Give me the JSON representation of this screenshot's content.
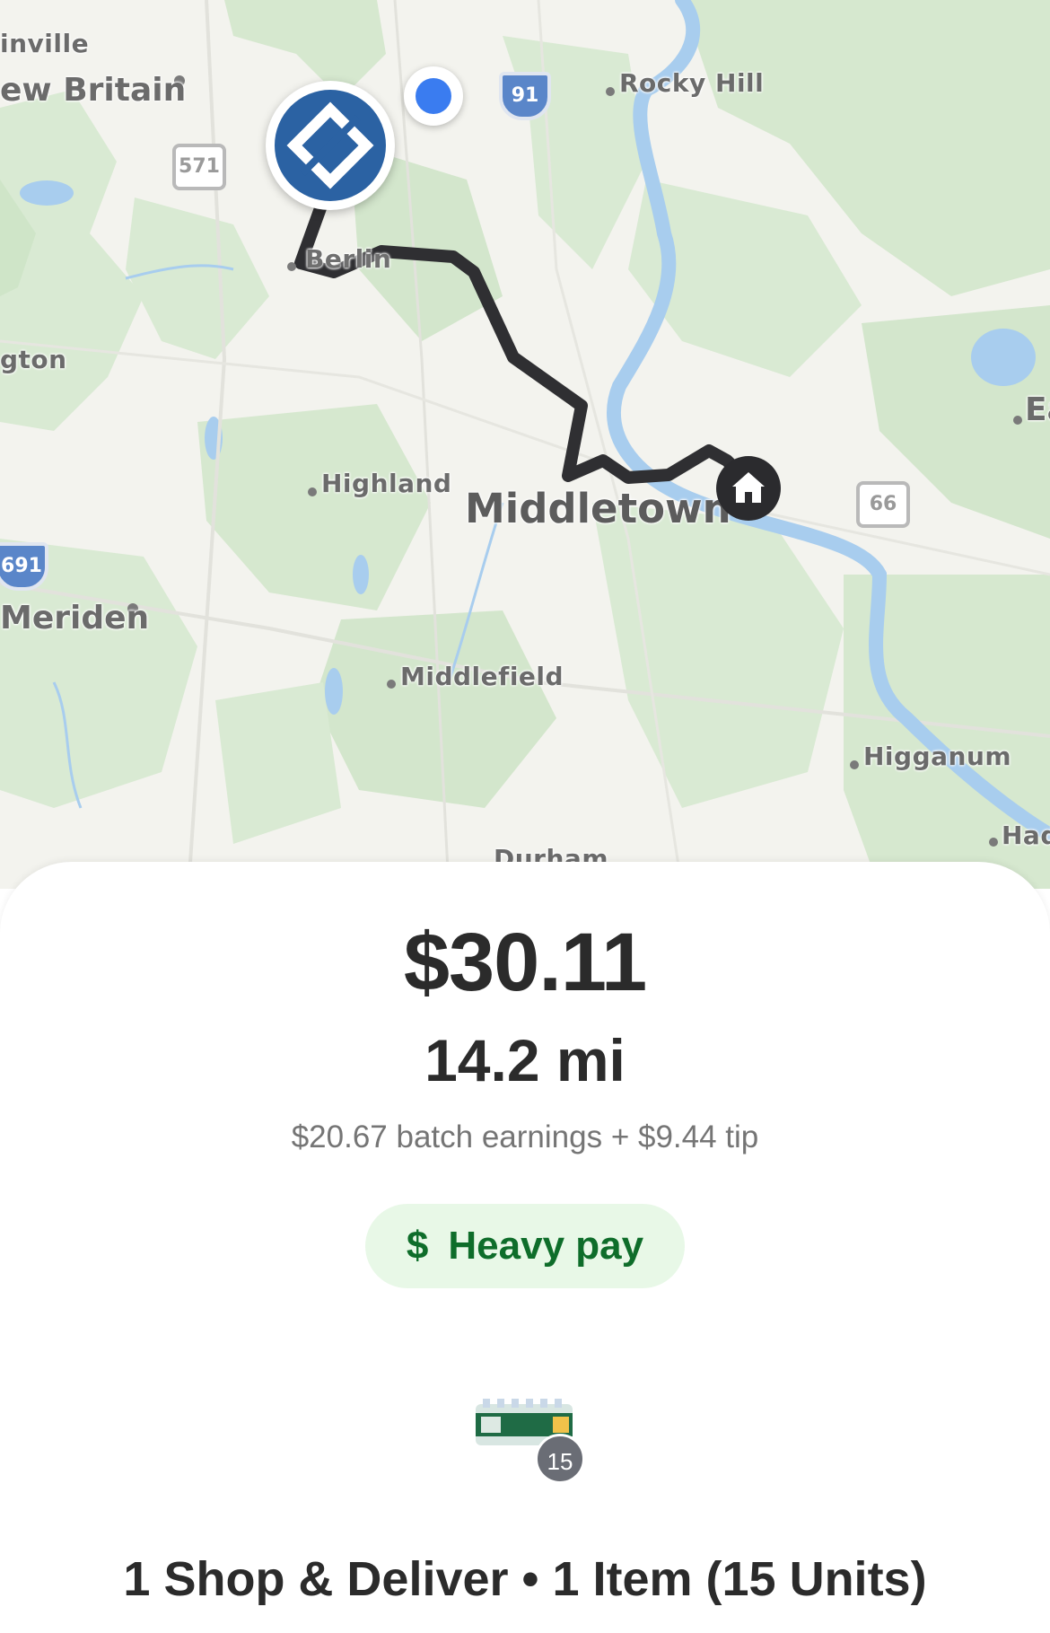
{
  "map": {
    "places": {
      "plainville": "inville",
      "new_britain": "ew Britain",
      "rocky_hill": "Rocky Hill",
      "berlin": "Berlin",
      "ington": "gton",
      "highland": "Highland",
      "middletown": "Middletown",
      "meriden": "Meriden",
      "middlefield": "Middlefield",
      "higganum": "Higganum",
      "haddam": "Had",
      "east": "Ea",
      "durham": "Durham"
    },
    "shields": {
      "i91": "91",
      "rt571": "571",
      "rt66": "66",
      "i691": "691"
    },
    "markers": {
      "store": "store-pin-icon",
      "user": "user-location-icon",
      "home": "home-icon"
    }
  },
  "offer": {
    "total": "$30.11",
    "distance": "14.2 mi",
    "breakdown": "$20.67 batch earnings + $9.44 tip",
    "badge": {
      "icon": "$",
      "label": "Heavy pay",
      "color": "#0e6d2a",
      "background": "#e8f8e7"
    },
    "item": {
      "image": "water-bottle-case-icon",
      "count": "15"
    },
    "summary": "1 Shop & Deliver • 1 Item (15 Units)"
  }
}
